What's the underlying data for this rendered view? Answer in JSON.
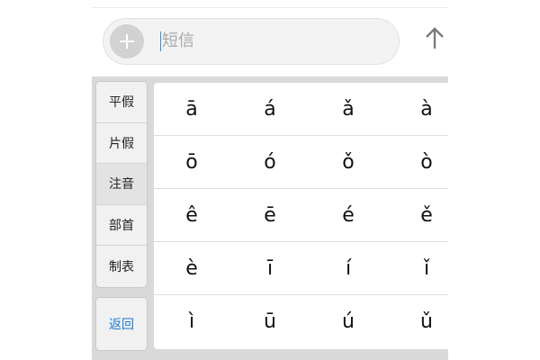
{
  "compose": {
    "add_icon": "plus-icon",
    "placeholder": "短信",
    "send_icon": "arrow-up-icon"
  },
  "keyboard": {
    "categories": [
      {
        "label": "平假",
        "active": false
      },
      {
        "label": "片假",
        "active": false
      },
      {
        "label": "注音",
        "active": true
      },
      {
        "label": "部首",
        "active": false
      },
      {
        "label": "制表",
        "active": false
      }
    ],
    "back_label": "返回",
    "rows": [
      [
        "ā",
        "á",
        "ǎ",
        "à"
      ],
      [
        "ō",
        "ó",
        "ǒ",
        "ò"
      ],
      [
        "ê",
        "ē",
        "é",
        "ě"
      ],
      [
        "è",
        "ī",
        "í",
        "ǐ"
      ],
      [
        "ì",
        "ū",
        "ú",
        "ǔ"
      ]
    ]
  },
  "colors": {
    "accent": "#1a7bd4",
    "keyboard_bg": "#d9d9d9",
    "key_bg": "#ffffff"
  }
}
